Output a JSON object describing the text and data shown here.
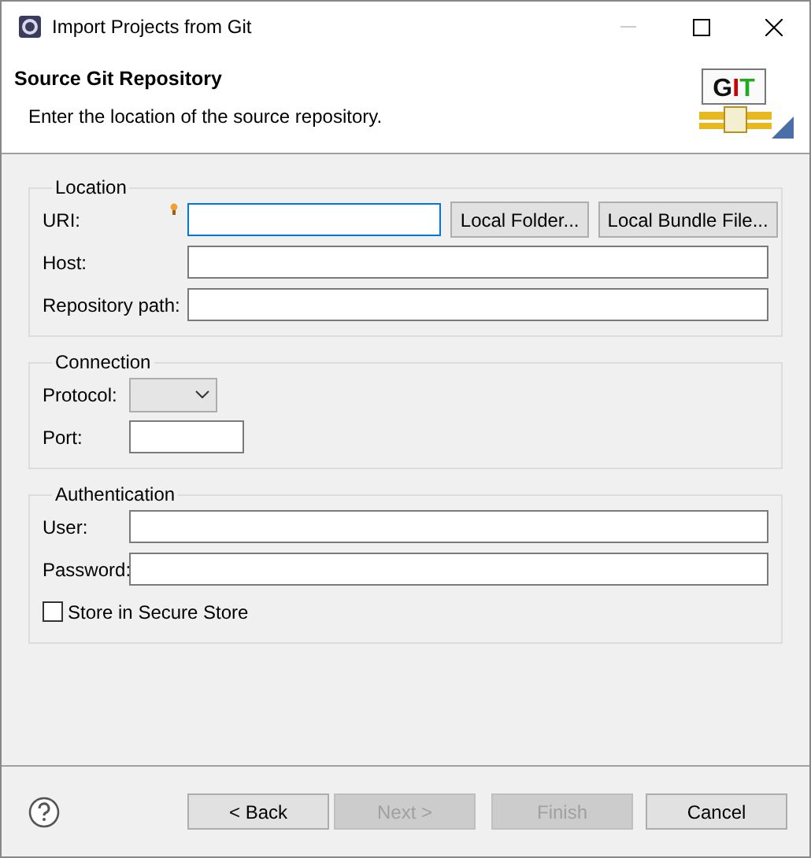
{
  "window": {
    "title": "Import Projects from Git"
  },
  "header": {
    "title": "Source Git Repository",
    "description": "Enter the location of the source repository.",
    "logo_text": "GIT"
  },
  "groups": [
    {
      "title": "Location",
      "rows": [
        {
          "label": "URI:",
          "kind": "text",
          "focused": true,
          "buttons": [
            "Local Folder...",
            "Local Bundle File..."
          ]
        },
        {
          "label": "Host:",
          "kind": "text",
          "focused": false
        },
        {
          "label": "Repository path:",
          "kind": "text",
          "focused": false
        }
      ]
    },
    {
      "title": "Connection",
      "rows": [
        {
          "label": "Protocol:",
          "kind": "select"
        },
        {
          "label": "Port:",
          "kind": "short-text",
          "focused": false
        }
      ]
    },
    {
      "title": "Authentication",
      "rows": [
        {
          "label": "User:",
          "kind": "text",
          "focused": false
        },
        {
          "label": "Password:",
          "kind": "text",
          "focused": false
        },
        {
          "label": "Store in Secure Store",
          "kind": "checkbox",
          "checked": false
        }
      ]
    }
  ],
  "buttons": [
    {
      "label": "< Back",
      "disabled": false
    },
    {
      "label": "Next >",
      "disabled": true
    },
    {
      "label": "Finish",
      "disabled": true
    },
    {
      "label": "Cancel",
      "disabled": false
    }
  ]
}
